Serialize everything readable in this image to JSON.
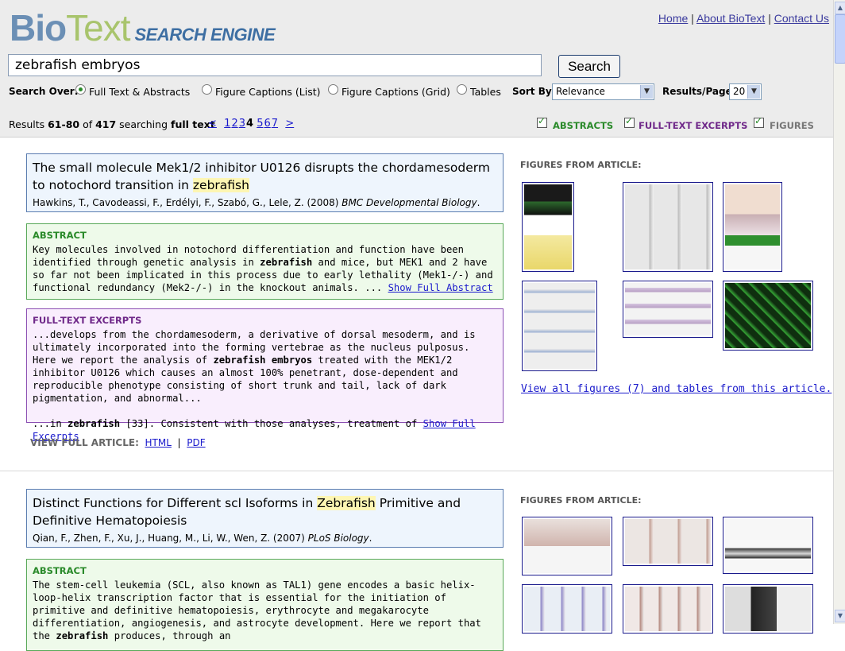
{
  "header": {
    "logo_bio": "Bio",
    "logo_text": "Text",
    "logo_sub": "SEARCH ENGINE",
    "links": [
      {
        "label": "Home"
      },
      {
        "label": "About BioText"
      },
      {
        "label": "Contact Us"
      }
    ],
    "separator": "|"
  },
  "search": {
    "query": "zebrafish embryos",
    "button_label": "Search"
  },
  "options": {
    "search_over_label": "Search Over:",
    "radios": [
      {
        "label": "Full Text & Abstracts",
        "selected": true
      },
      {
        "label": "Figure Captions (List)",
        "selected": false
      },
      {
        "label": "Figure Captions (Grid)",
        "selected": false
      },
      {
        "label": "Tables",
        "selected": false
      }
    ],
    "sort_label": "Sort By:",
    "sort_value": "Relevance",
    "per_page_label": "Results/Page:",
    "per_page_value": "20"
  },
  "results_info": {
    "prefix": "Results ",
    "range": "61-80",
    "of": " of ",
    "total": "417",
    "searching": " searching ",
    "scope": "full text"
  },
  "pager": {
    "prev": "<",
    "pages": [
      "1",
      "2",
      "3",
      "4",
      "5",
      "6",
      "7"
    ],
    "current": "4",
    "next": ">"
  },
  "filters": [
    {
      "label": "ABSTRACTS",
      "checked": true,
      "color": "#2a8a2a"
    },
    {
      "label": "FULL-TEXT EXCERPTS",
      "checked": true,
      "color": "#702a8a"
    },
    {
      "label": "FIGURES",
      "checked": true,
      "color": "#777777"
    }
  ],
  "results": [
    {
      "title_before": "The small molecule Mek1/2 inhibitor U0126 disrupts the chordamesoderm to notochord transition in ",
      "title_hl": "zebrafish",
      "title_after": "",
      "authors": "Hawkins, T., Cavodeassi, F., Erdélyi, F., Szabó, G., Lele, Z. (2008) ",
      "journal": "BMC Developmental Biology",
      "journal_suffix": ".",
      "abstract_head": "ABSTRACT",
      "abstract_parts": {
        "a": "Key molecules involved in notochord differentiation and function have been identified through genetic analysis in ",
        "b": "zebrafish",
        "c": " and mice, but MEK1 and 2 have so far not been implicated in this process due to early lethality (Mek1-/-) and functional redundancy (Mek2-/-) in the knockout animals. ... ",
        "link": "Show Full Abstract"
      },
      "excerpt_head": "FULL-TEXT EXCERPTS",
      "excerpt_parts": {
        "a": "...develops from the chordamesoderm, a derivative of dorsal mesoderm, and is ultimately incorporated into the forming vertebrae as the nucleus pulposus. Here we report the analysis of ",
        "b": "zebrafish embryos",
        "c": " treated with the MEK1/2 inhibitor U0126 which causes an almost 100% penetrant, dose-dependent and reproducible phenotype consisting of short trunk and tail, lack of dark pigmentation, and abnormal...",
        "d": "...in ",
        "e": "zebrafish",
        "f": " [33]. Consistent with those analyses, treatment of ",
        "link": "Show Full Excerpts"
      },
      "view_full_label": "VIEW FULL ARTICLE:",
      "html_label": "HTML",
      "pdf_label": "PDF",
      "figures_head": "FIGURES FROM ARTICLE:",
      "view_all": "View all figures (7) and tables from this article."
    },
    {
      "title_before": "Distinct Functions for Different scl Isoforms in ",
      "title_hl": "Zebrafish",
      "title_after": " Primitive and Definitive Hematopoiesis",
      "authors": "Qian, F., Zhen, F., Xu, J., Huang, M., Li, W., Wen, Z. (2007) ",
      "journal": "PLoS Biology",
      "journal_suffix": ".",
      "abstract_head": "ABSTRACT",
      "abstract_parts": {
        "a": "The stem-cell leukemia (SCL, also known as TAL1) gene encodes a basic helix-loop-helix transcription factor that is essential for the initiation of primitive and definitive hematopoiesis, erythrocyte and megakarocyte differentiation, angiogenesis, and astrocyte development. Here we report that the ",
        "b": "zebrafish",
        "c": " produces, through an"
      },
      "figures_head": "FIGURES FROM ARTICLE:"
    }
  ]
}
